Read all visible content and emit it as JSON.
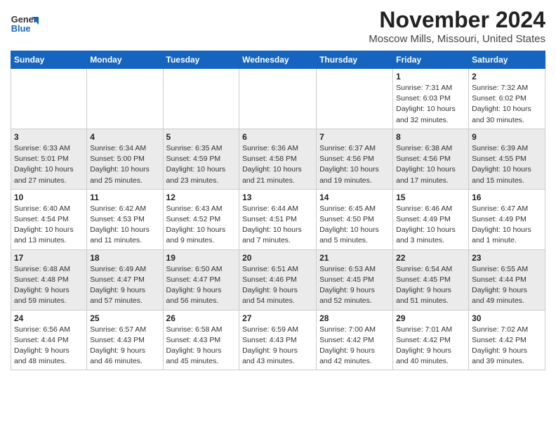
{
  "header": {
    "logo_line1": "General",
    "logo_line2": "Blue",
    "title": "November 2024",
    "subtitle": "Moscow Mills, Missouri, United States"
  },
  "days_of_week": [
    "Sunday",
    "Monday",
    "Tuesday",
    "Wednesday",
    "Thursday",
    "Friday",
    "Saturday"
  ],
  "weeks": [
    [
      {
        "day": "",
        "info": ""
      },
      {
        "day": "",
        "info": ""
      },
      {
        "day": "",
        "info": ""
      },
      {
        "day": "",
        "info": ""
      },
      {
        "day": "",
        "info": ""
      },
      {
        "day": "1",
        "info": "Sunrise: 7:31 AM\nSunset: 6:03 PM\nDaylight: 10 hours\nand 32 minutes."
      },
      {
        "day": "2",
        "info": "Sunrise: 7:32 AM\nSunset: 6:02 PM\nDaylight: 10 hours\nand 30 minutes."
      }
    ],
    [
      {
        "day": "3",
        "info": "Sunrise: 6:33 AM\nSunset: 5:01 PM\nDaylight: 10 hours\nand 27 minutes."
      },
      {
        "day": "4",
        "info": "Sunrise: 6:34 AM\nSunset: 5:00 PM\nDaylight: 10 hours\nand 25 minutes."
      },
      {
        "day": "5",
        "info": "Sunrise: 6:35 AM\nSunset: 4:59 PM\nDaylight: 10 hours\nand 23 minutes."
      },
      {
        "day": "6",
        "info": "Sunrise: 6:36 AM\nSunset: 4:58 PM\nDaylight: 10 hours\nand 21 minutes."
      },
      {
        "day": "7",
        "info": "Sunrise: 6:37 AM\nSunset: 4:56 PM\nDaylight: 10 hours\nand 19 minutes."
      },
      {
        "day": "8",
        "info": "Sunrise: 6:38 AM\nSunset: 4:56 PM\nDaylight: 10 hours\nand 17 minutes."
      },
      {
        "day": "9",
        "info": "Sunrise: 6:39 AM\nSunset: 4:55 PM\nDaylight: 10 hours\nand 15 minutes."
      }
    ],
    [
      {
        "day": "10",
        "info": "Sunrise: 6:40 AM\nSunset: 4:54 PM\nDaylight: 10 hours\nand 13 minutes."
      },
      {
        "day": "11",
        "info": "Sunrise: 6:42 AM\nSunset: 4:53 PM\nDaylight: 10 hours\nand 11 minutes."
      },
      {
        "day": "12",
        "info": "Sunrise: 6:43 AM\nSunset: 4:52 PM\nDaylight: 10 hours\nand 9 minutes."
      },
      {
        "day": "13",
        "info": "Sunrise: 6:44 AM\nSunset: 4:51 PM\nDaylight: 10 hours\nand 7 minutes."
      },
      {
        "day": "14",
        "info": "Sunrise: 6:45 AM\nSunset: 4:50 PM\nDaylight: 10 hours\nand 5 minutes."
      },
      {
        "day": "15",
        "info": "Sunrise: 6:46 AM\nSunset: 4:49 PM\nDaylight: 10 hours\nand 3 minutes."
      },
      {
        "day": "16",
        "info": "Sunrise: 6:47 AM\nSunset: 4:49 PM\nDaylight: 10 hours\nand 1 minute."
      }
    ],
    [
      {
        "day": "17",
        "info": "Sunrise: 6:48 AM\nSunset: 4:48 PM\nDaylight: 9 hours\nand 59 minutes."
      },
      {
        "day": "18",
        "info": "Sunrise: 6:49 AM\nSunset: 4:47 PM\nDaylight: 9 hours\nand 57 minutes."
      },
      {
        "day": "19",
        "info": "Sunrise: 6:50 AM\nSunset: 4:47 PM\nDaylight: 9 hours\nand 56 minutes."
      },
      {
        "day": "20",
        "info": "Sunrise: 6:51 AM\nSunset: 4:46 PM\nDaylight: 9 hours\nand 54 minutes."
      },
      {
        "day": "21",
        "info": "Sunrise: 6:53 AM\nSunset: 4:45 PM\nDaylight: 9 hours\nand 52 minutes."
      },
      {
        "day": "22",
        "info": "Sunrise: 6:54 AM\nSunset: 4:45 PM\nDaylight: 9 hours\nand 51 minutes."
      },
      {
        "day": "23",
        "info": "Sunrise: 6:55 AM\nSunset: 4:44 PM\nDaylight: 9 hours\nand 49 minutes."
      }
    ],
    [
      {
        "day": "24",
        "info": "Sunrise: 6:56 AM\nSunset: 4:44 PM\nDaylight: 9 hours\nand 48 minutes."
      },
      {
        "day": "25",
        "info": "Sunrise: 6:57 AM\nSunset: 4:43 PM\nDaylight: 9 hours\nand 46 minutes."
      },
      {
        "day": "26",
        "info": "Sunrise: 6:58 AM\nSunset: 4:43 PM\nDaylight: 9 hours\nand 45 minutes."
      },
      {
        "day": "27",
        "info": "Sunrise: 6:59 AM\nSunset: 4:43 PM\nDaylight: 9 hours\nand 43 minutes."
      },
      {
        "day": "28",
        "info": "Sunrise: 7:00 AM\nSunset: 4:42 PM\nDaylight: 9 hours\nand 42 minutes."
      },
      {
        "day": "29",
        "info": "Sunrise: 7:01 AM\nSunset: 4:42 PM\nDaylight: 9 hours\nand 40 minutes."
      },
      {
        "day": "30",
        "info": "Sunrise: 7:02 AM\nSunset: 4:42 PM\nDaylight: 9 hours\nand 39 minutes."
      }
    ]
  ]
}
